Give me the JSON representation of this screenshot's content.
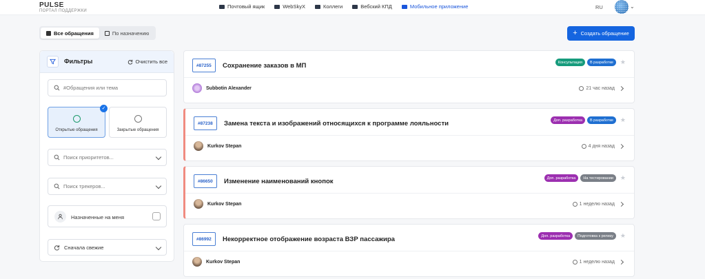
{
  "brand": {
    "name": "PULSE",
    "subtitle": "ПОРТАЛ ПОДДЕРЖКИ"
  },
  "nav": [
    {
      "label": "Почтовый ящик",
      "active": false
    },
    {
      "label": "WebSkyX",
      "active": false
    },
    {
      "label": "Коллеги",
      "active": false
    },
    {
      "label": "Вебский КПД",
      "active": false
    },
    {
      "label": "Мобильное приложение",
      "active": true
    }
  ],
  "language": "RU",
  "view_toggle": {
    "all": "Все обращения",
    "assigned": "По назначению"
  },
  "create_button": "Создать обращение",
  "filters": {
    "title": "Фильтры",
    "clear_all": "Очистить все",
    "search_placeholder": "#Обращения или тема",
    "status_open": "Открытые обращения",
    "status_closed": "Закрытые обращения",
    "priority_placeholder": "Поиск приоритетов...",
    "tracker_placeholder": "Поиск трекеров...",
    "assigned_to_me": "Назначенные на меня",
    "sort": "Сначала свежие"
  },
  "colors": {
    "accent": "#1565e0",
    "badge_consult": "#169b7c",
    "badge_dev": "#1f6fd1",
    "badge_extra_dev": "#9c2fb0",
    "badge_testing": "#7a7f87",
    "flag": "#f08b80"
  },
  "tickets": [
    {
      "id": "#87255",
      "title": "Сохранение заказов в МП",
      "badges": [
        "Консультация",
        "В разработке"
      ],
      "author": "Subbotin Alexander",
      "time": "21 час назад",
      "flagged": false
    },
    {
      "id": "#87238",
      "title": "Замена текста и изображений относящихся к программе лояльности",
      "badges": [
        "Доп. разработка",
        "В разработке"
      ],
      "author": "Kurkov Stepan",
      "time": "4 дня назад",
      "flagged": true
    },
    {
      "id": "#86650",
      "title": "Изменение наименований кнопок",
      "badges": [
        "Доп. разработка",
        "На тестировании"
      ],
      "author": "Kurkov Stepan",
      "time": "1 неделю назад",
      "flagged": true
    },
    {
      "id": "#86992",
      "title": "Некорректное отображение возраста ВЗР пассажира",
      "badges": [
        "Доп. разработка",
        "Подготовка к релизу"
      ],
      "author": "Kurkov Stepan",
      "time": "1 неделю назад",
      "flagged": false
    }
  ]
}
